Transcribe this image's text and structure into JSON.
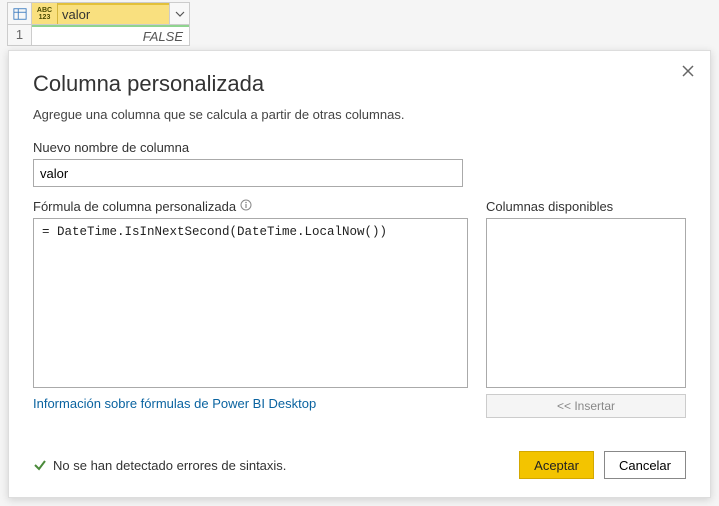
{
  "preview": {
    "column_name": "valor",
    "type_label_top": "ABC",
    "type_label_bottom": "123",
    "row_number": "1",
    "row_value": "FALSE"
  },
  "dialog": {
    "title": "Columna personalizada",
    "subtitle": "Agregue una columna que se calcula a partir de otras columnas.",
    "name_label": "Nuevo nombre de columna",
    "name_value": "valor",
    "formula_label": "Fórmula de columna personalizada",
    "formula_value": "= DateTime.IsInNextSecond(DateTime.LocalNow())",
    "available_label": "Columnas disponibles",
    "insert_label": "<< Insertar",
    "learn_link": "Información sobre fórmulas de Power BI Desktop",
    "status_text": "No se han detectado errores de sintaxis.",
    "accept_label": "Aceptar",
    "cancel_label": "Cancelar"
  }
}
